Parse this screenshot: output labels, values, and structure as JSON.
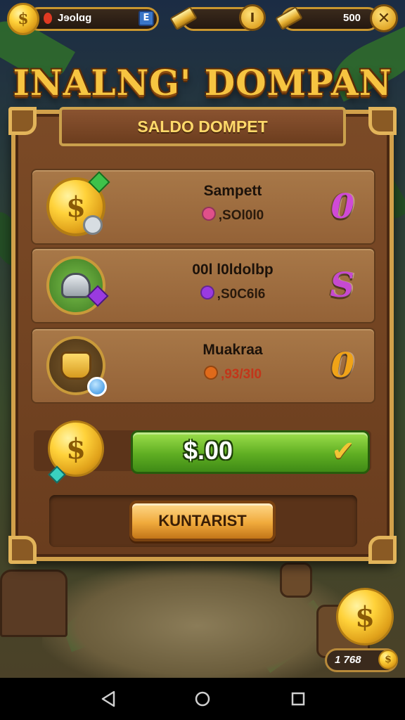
{
  "hud": {
    "player_name": "Jɘolɑg",
    "currency_badge": "E",
    "gold_level": "I",
    "gold_amount": "500",
    "close_icon": "close-icon"
  },
  "title": "INALNG' DOMPAN",
  "banner": "SALDO DOMPET",
  "wallet_rows": [
    {
      "name": "Sampett",
      "amount": ",SOl0l0",
      "badge": "0",
      "badge_color": "#d04ad6",
      "gem_color": "#e0508a",
      "icon": "gold-coin-icon"
    },
    {
      "name": "00l l0ldolbp",
      "amount": ",S0C6l6",
      "badge": "S",
      "badge_color": "#c64ad0",
      "gem_color": "#9a3ae0",
      "icon": "knight-helmet-icon"
    },
    {
      "name": "Muakraa",
      "amount": ",93/3l0",
      "badge": "0",
      "badge_color": "#f0a318",
      "gem_color": "#e06a1a",
      "icon": "treasure-pot-icon"
    }
  ],
  "balance": {
    "value": "$.00",
    "icon": "checkmark-icon"
  },
  "action_button": "KUNTARIST",
  "corner_counter": "1 768",
  "navbar": {
    "back": "back-icon",
    "home": "home-icon",
    "recents": "recents-icon"
  }
}
